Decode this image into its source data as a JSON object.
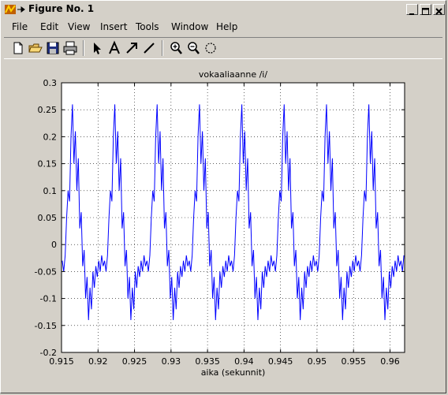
{
  "window": {
    "title": "Figure No. 1"
  },
  "menu": {
    "items": [
      "File",
      "Edit",
      "View",
      "Insert",
      "Tools",
      "Window",
      "Help"
    ]
  },
  "toolbar": {
    "icons": [
      "new-figure-icon",
      "open-file-icon",
      "save-icon",
      "print-icon",
      "arrow-select-icon",
      "insert-text-icon",
      "insert-arrow-icon",
      "insert-line-icon",
      "zoom-in-icon",
      "zoom-out-icon",
      "rotate-3d-icon"
    ]
  },
  "colors": {
    "line": "#0000ff",
    "axes_bg": "#ffffff",
    "figure_bg": "#d4d0c8"
  },
  "chart_data": {
    "type": "line",
    "title": "vokaaliaanne /i/",
    "xlabel": "aika (sekunnit)",
    "ylabel": "",
    "xlim": [
      0.915,
      0.962
    ],
    "ylim": [
      -0.2,
      0.3
    ],
    "xticks": [
      "0.915",
      "0.92",
      "0.925",
      "0.93",
      "0.935",
      "0.94",
      "0.945",
      "0.95",
      "0.955",
      "0.96"
    ],
    "yticks": [
      "-0.2",
      "-0.15",
      "-0.1",
      "-0.05",
      "0",
      "0.05",
      "0.1",
      "0.15",
      "0.2",
      "0.25",
      "0.3"
    ],
    "grid": true,
    "period": 0.0058,
    "first_peak_x": 0.9165,
    "series": [
      {
        "name": "",
        "periodic_shape": [
          [
            0.0,
            0.26
          ],
          [
            0.0002,
            0.15
          ],
          [
            0.0004,
            0.21
          ],
          [
            0.0006,
            0.1
          ],
          [
            0.0008,
            0.16
          ],
          [
            0.001,
            0.03
          ],
          [
            0.0012,
            0.06
          ],
          [
            0.0014,
            -0.04
          ],
          [
            0.0016,
            -0.01
          ],
          [
            0.0018,
            -0.1
          ],
          [
            0.002,
            -0.06
          ],
          [
            0.0022,
            -0.14
          ],
          [
            0.0024,
            -0.08
          ],
          [
            0.0026,
            -0.12
          ],
          [
            0.0028,
            -0.05
          ],
          [
            0.003,
            -0.08
          ],
          [
            0.0032,
            -0.04
          ],
          [
            0.0034,
            -0.06
          ],
          [
            0.0036,
            -0.03
          ],
          [
            0.0038,
            -0.05
          ],
          [
            0.004,
            -0.02
          ],
          [
            0.0042,
            -0.04
          ],
          [
            0.0044,
            -0.03
          ],
          [
            0.0046,
            -0.05
          ],
          [
            0.0048,
            -0.02
          ],
          [
            0.005,
            0.05
          ],
          [
            0.0052,
            0.1
          ],
          [
            0.0054,
            0.08
          ],
          [
            0.0056,
            0.2
          ],
          [
            0.0058,
            0.26
          ]
        ]
      }
    ]
  }
}
